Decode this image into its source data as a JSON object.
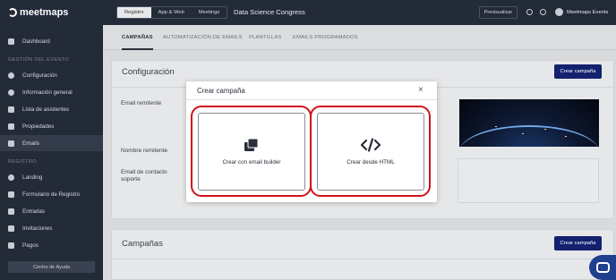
{
  "app": {
    "logo_text": "meetmaps"
  },
  "sidebar": {
    "dashboard": "Dashboard",
    "section_event": "GESTIÓN DEL EVENTO",
    "event_items": [
      "Configuración",
      "Información general",
      "Lista de asistentes",
      "Propiedades",
      "Emails"
    ],
    "section_registro": "REGISTRO",
    "registro_items": [
      "Landing",
      "Formulario de Registro",
      "Entradas",
      "Invitaciones",
      "Pagos"
    ],
    "help_button": "Centro de Ayuda"
  },
  "topbar": {
    "segments": [
      "Registro",
      "App & Web",
      "Meetings"
    ],
    "event_name": "Data Science Congress",
    "preview_button": "Previsualizar",
    "user_name": "Meetmaps Events"
  },
  "tabs": [
    "CAMPAÑAS",
    "AUTOMATIZACIÓN DE EMAILS",
    "PLANTILLAS",
    "EMAILS PROGRAMADOS"
  ],
  "config_card": {
    "title": "Configuración",
    "button": "Crear campaña",
    "labels": {
      "sender": "Email remitente",
      "sender_name": "Nombre remitente",
      "support": "Email de contacto soporte"
    }
  },
  "campaigns_card": {
    "title": "Campañas",
    "button": "Crear campaña"
  },
  "modal": {
    "title": "Crear campaña",
    "close": "×",
    "option_builder": "Crear con email builder",
    "option_html": "Crear desde HTML"
  },
  "colors": {
    "sidebar_bg": "#232a38",
    "primary": "#13216e",
    "highlight": "#d0121b"
  },
  "icons": {
    "builder": "layers-icon",
    "html": "code-icon",
    "close": "close-icon",
    "chat": "chat-icon"
  }
}
